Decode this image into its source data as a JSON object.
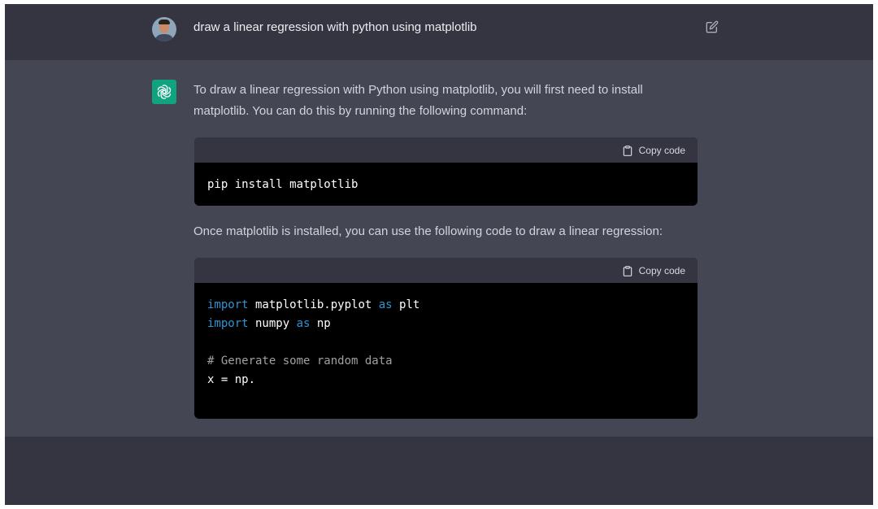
{
  "conversation": {
    "user_message": "draw a linear regression with python using matplotlib",
    "assistant": {
      "intro": "To draw a linear regression with Python using matplotlib, you will first need to install matplotlib. You can do this by running the following command:",
      "followup": "Once matplotlib is installed, you can use the following code to draw a linear regression:",
      "code_blocks": [
        {
          "copy_label": "Copy code",
          "lines": [
            {
              "code": "pip install matplotlib"
            }
          ]
        },
        {
          "copy_label": "Copy code",
          "lines": [
            {
              "kw1": "import",
              "mid": " matplotlib.pyplot ",
              "kw2": "as",
              "tail": " plt"
            },
            {
              "kw1": "import",
              "mid": " numpy ",
              "kw2": "as",
              "tail": " np"
            },
            {
              "blank": ""
            },
            {
              "comment": "# Generate some random data"
            },
            {
              "code": "x = np."
            }
          ]
        }
      ]
    }
  },
  "icons": {
    "edit": "edit-icon",
    "copy": "clipboard-icon",
    "assistant_logo": "openai-logo-icon",
    "user_avatar": "user-avatar"
  },
  "colors": {
    "user_row_bg": "#343541",
    "assistant_row_bg": "#444654",
    "code_bg": "#000000",
    "code_header_bg": "#343541",
    "keyword": "#2e95d3",
    "comment": "#a0a0a0",
    "assistant_logo_bg": "#10a37f"
  }
}
